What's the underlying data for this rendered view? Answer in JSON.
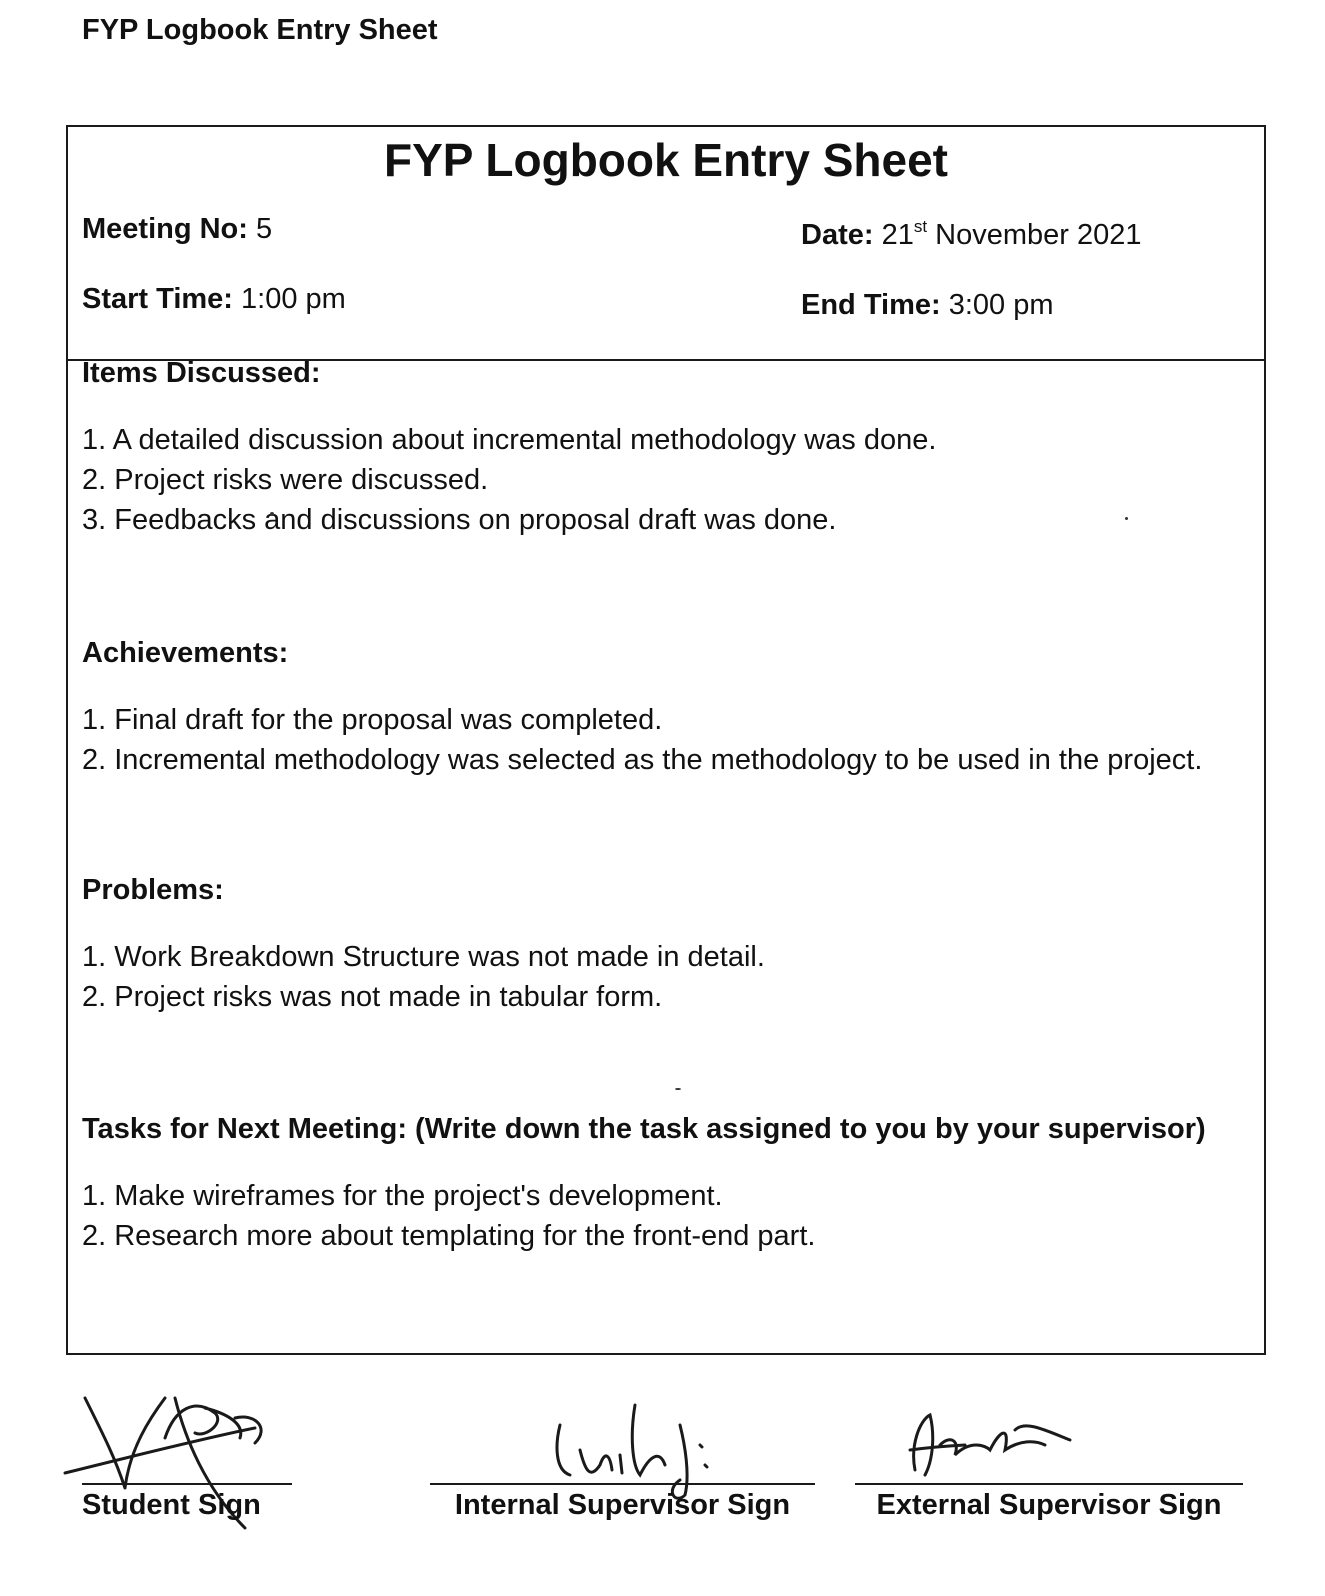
{
  "page_header": "FYP Logbook Entry Sheet",
  "sheet": {
    "title": "FYP Logbook Entry Sheet",
    "meeting_no_label": "Meeting No:",
    "meeting_no_value": "5",
    "date_label": "Date:",
    "date_day": "21",
    "date_suffix": "st",
    "date_rest": "November 2021",
    "start_time_label": "Start Time:",
    "start_time_value": "1:00 pm",
    "end_time_label": "End Time:",
    "end_time_value": "3:00 pm"
  },
  "sections": {
    "items_discussed": {
      "title": "Items Discussed:",
      "items": [
        "1. A detailed discussion about incremental methodology was done.",
        "2. Project risks were discussed.",
        "3. Feedbacks and discussions on proposal draft was done."
      ]
    },
    "achievements": {
      "title": "Achievements:",
      "items": [
        "1. Final draft for the proposal was completed.",
        "2. Incremental methodology was selected as the methodology to be used in the project."
      ]
    },
    "problems": {
      "title": "Problems:",
      "items": [
        "1. Work Breakdown Structure was not made in detail.",
        "2. Project risks was not made in tabular form."
      ]
    },
    "tasks": {
      "title": "Tasks for Next Meeting: (Write down the task assigned to you by your supervisor)",
      "items": [
        "1. Make wireframes for the project's development.",
        "2. Research more about templating for the front-end part."
      ]
    }
  },
  "signatures": {
    "student_label": "Student Sign",
    "internal_label": "Internal Supervisor Sign",
    "external_label": "External Supervisor Sign"
  },
  "colors": {
    "ink": "#111111",
    "paper": "#ffffff",
    "border": "#1a1a1a"
  }
}
